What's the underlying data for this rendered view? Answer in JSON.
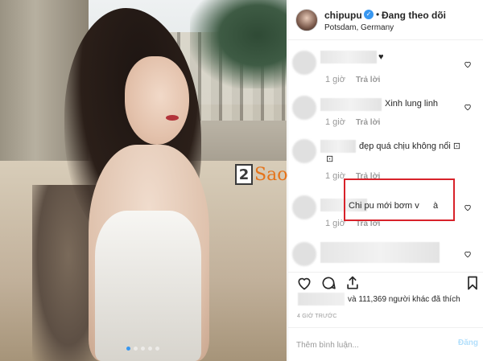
{
  "watermark": {
    "badge": "2",
    "word": "Sao"
  },
  "carousel": {
    "count": 5,
    "active": 0
  },
  "header": {
    "username": "chipupu",
    "separator": "•",
    "follow_label": "Đang theo dõi",
    "location": "Potsdam, Germany"
  },
  "comments": [
    {
      "text": "♥",
      "time": "1 giờ",
      "reply": "Trả lời"
    },
    {
      "text": "Xinh lung linh",
      "time": "1 giờ",
      "reply": "Trả lời"
    },
    {
      "text": "đẹp quá chịu không nổi ⊡",
      "text2": "⊡",
      "time": "1 giờ",
      "reply": "Trả lời"
    },
    {
      "text": "Chi pu mới bơm v",
      "text_tail": "à",
      "time": "1 giờ",
      "reply": "Trả lời"
    },
    {
      "text": "",
      "time": "",
      "reply": ""
    }
  ],
  "actions": {
    "like_icon": "heart-icon",
    "comment_icon": "comment-icon",
    "share_icon": "share-icon",
    "save_icon": "bookmark-icon"
  },
  "likes": {
    "text": "và 111,369 người khác đã thích"
  },
  "timeago": "4 GIỜ TRƯỚC",
  "composer": {
    "placeholder": "Thêm bình luận...",
    "post_label": "Đăng"
  },
  "colors": {
    "accent": "#3897f0",
    "highlight_box": "#d8222a",
    "watermark": "#e5731b"
  }
}
